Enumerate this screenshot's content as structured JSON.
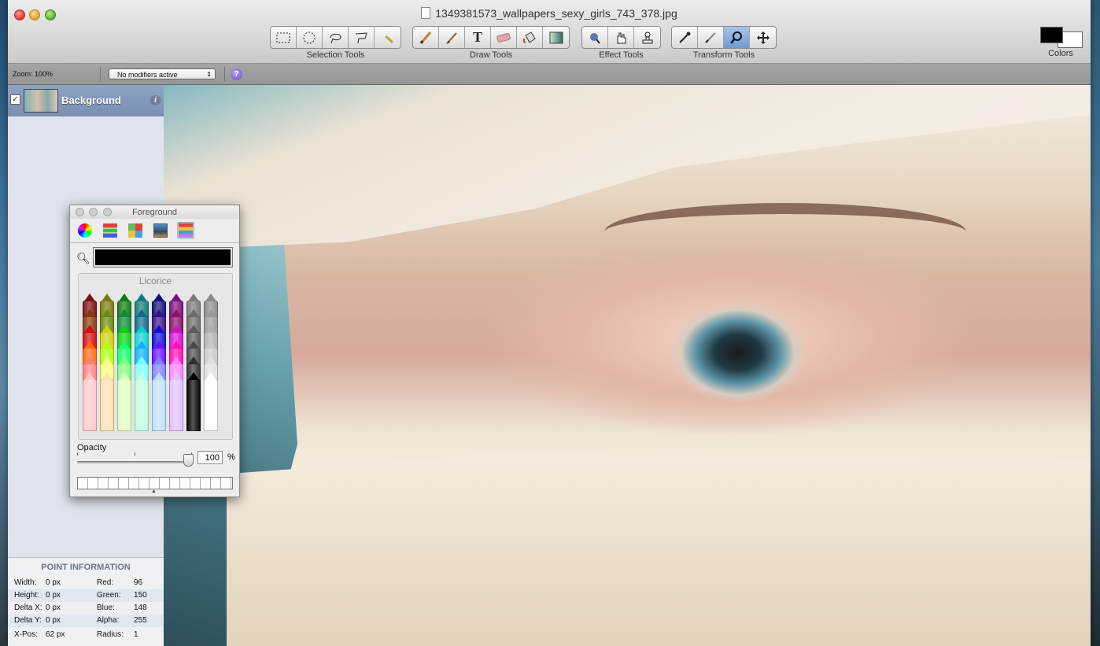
{
  "window": {
    "title": "1349381573_wallpapers_sexy_girls_743_378.jpg"
  },
  "toolbar": {
    "groups": [
      {
        "label": "Selection Tools",
        "tools": [
          "rect-select-icon",
          "ellipse-select-icon",
          "lasso-icon",
          "poly-lasso-icon",
          "magic-wand-icon"
        ]
      },
      {
        "label": "Draw Tools",
        "tools": [
          "pencil-icon",
          "paintbrush-icon",
          "text-icon",
          "eraser-icon",
          "paint-bucket-icon",
          "gradient-icon"
        ]
      },
      {
        "label": "Effect Tools",
        "tools": [
          "smudge-icon",
          "hand-effect-icon",
          "stamp-icon"
        ]
      },
      {
        "label": "Transform Tools",
        "tools": [
          "eyedropper-icon",
          "brush-icon",
          "zoom-icon",
          "move-icon"
        ]
      }
    ],
    "text_glyph": "T",
    "colors_label": "Colors",
    "foreground_color": "#000000",
    "background_color": "#ffffff"
  },
  "options": {
    "zoom_label": "Zoom: 100%",
    "modifiers": "No modifiers active",
    "help": "?"
  },
  "layers": [
    {
      "name": "Background",
      "visible": true,
      "info": "i"
    }
  ],
  "point_info": {
    "title": "POINT INFORMATION",
    "rows": [
      {
        "l1": "Width:",
        "v1": "0 px",
        "l2": "Red:",
        "v2": "96"
      },
      {
        "l1": "Height:",
        "v1": "0 px",
        "l2": "Green:",
        "v2": "150"
      },
      {
        "l1": "Delta X:",
        "v1": "0 px",
        "l2": "Blue:",
        "v2": "148"
      },
      {
        "l1": "Delta Y:",
        "v1": "0 px",
        "l2": "Alpha:",
        "v2": "255"
      },
      {
        "l1": "X-Pos:",
        "v1": "62 px",
        "l2": "Radius:",
        "v2": "1"
      }
    ]
  },
  "foreground_panel": {
    "title": "Foreground",
    "color_name": "Licorice",
    "current_color": "#000000",
    "opacity_label": "Opacity",
    "opacity_value": "100",
    "opacity_unit": "%",
    "opacity_level": 1.0,
    "crayon_rows": [
      [
        "#7a1010",
        "#7a7a10",
        "#107a10",
        "#107a7a",
        "#10107a",
        "#7a107a",
        "#7a7a7a",
        "#8a8a8a"
      ],
      [
        "#8a3a10",
        "#6a8a10",
        "#108a3a",
        "#106a8a",
        "#3a108a",
        "#8a106a",
        "#6a6a6a",
        "#9a9a9a"
      ],
      [
        "#d01010",
        "#d0d010",
        "#10d010",
        "#10d0d0",
        "#1010d0",
        "#d010d0",
        "#5a5a5a",
        "#b0b0b0"
      ],
      [
        "#ff6a10",
        "#b0ff10",
        "#10ff6a",
        "#10b0ff",
        "#6a10ff",
        "#ff10b0",
        "#4a4a4a",
        "#c8c8c8"
      ],
      [
        "#ff8080",
        "#ffff80",
        "#80ff80",
        "#80ffff",
        "#8080ff",
        "#ff80ff",
        "#303030",
        "#e0e0e0"
      ],
      [
        "#ffc8c8",
        "#ffe0b0",
        "#e0ffc0",
        "#c0ffe0",
        "#c0e0ff",
        "#e0c0ff",
        "#000000",
        "#ffffff"
      ]
    ]
  }
}
